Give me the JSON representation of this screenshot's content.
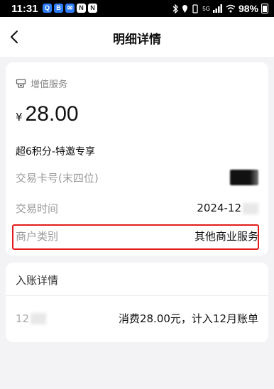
{
  "status_bar": {
    "time": "11:31",
    "icons": [
      "Q",
      "B",
      "✉",
      "N",
      "N"
    ],
    "network": "5G",
    "battery": "98%"
  },
  "nav": {
    "title": "明细详情",
    "back_icon": "chevron-left-icon"
  },
  "service": {
    "label": "增值服务",
    "icon": "receipt-icon"
  },
  "amount": {
    "currency": "¥",
    "value": "28.00"
  },
  "description": "超6积分-特邀专享",
  "details": {
    "card_label": "交易卡号(末四位)",
    "time_label": "交易时间",
    "time_value": "2024-12",
    "merchant_label": "商户类别",
    "merchant_value": "其他商业服务"
  },
  "entry": {
    "title": "入账详情",
    "date": "12",
    "detail": "消费28.00元，计入12月账单"
  },
  "colors": {
    "highlight": "#e41b1b",
    "background": "#f3f3f6"
  }
}
